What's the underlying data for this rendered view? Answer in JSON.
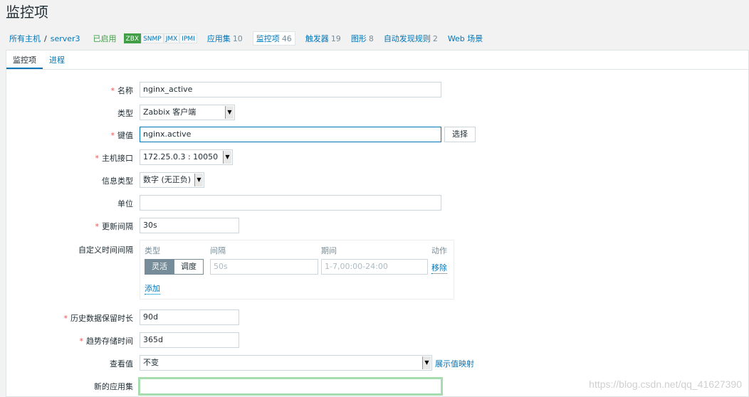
{
  "page": {
    "title": "监控项"
  },
  "breadcrumb": {
    "all_hosts": "所有主机",
    "separator": "/",
    "host": "server3",
    "status": "已启用",
    "badges": [
      "ZBX",
      "SNMP",
      "JMX",
      "IPMI"
    ],
    "links": [
      {
        "label": "应用集",
        "count": "10"
      },
      {
        "label": "监控项",
        "count": "46"
      },
      {
        "label": "触发器",
        "count": "19"
      },
      {
        "label": "图形",
        "count": "8"
      },
      {
        "label": "自动发现规则",
        "count": "2"
      },
      {
        "label": "Web 场景",
        "count": ""
      }
    ]
  },
  "tabs": [
    "监控项",
    "进程"
  ],
  "form": {
    "name": {
      "label": "名称",
      "value": "nginx_active"
    },
    "type": {
      "label": "类型",
      "value": "Zabbix 客户端"
    },
    "key": {
      "label": "键值",
      "value": "nginx.active",
      "select_button": "选择"
    },
    "interface": {
      "label": "主机接口",
      "value": "172.25.0.3 : 10050"
    },
    "info_type": {
      "label": "信息类型",
      "value": "数字 (无正负)"
    },
    "units": {
      "label": "单位",
      "value": ""
    },
    "interval": {
      "label": "更新间隔",
      "value": "30s"
    },
    "custom_intervals": {
      "label": "自定义时间间隔",
      "headers": [
        "类型",
        "间隔",
        "期间",
        "动作"
      ],
      "mode_flexible": "灵活",
      "mode_scheduling": "调度",
      "interval_placeholder": "50s",
      "period_placeholder": "1-7,00:00-24:00",
      "remove": "移除",
      "add": "添加"
    },
    "history": {
      "label": "历史数据保留时长",
      "value": "90d"
    },
    "trends": {
      "label": "趋势存储时间",
      "value": "365d"
    },
    "show_value": {
      "label": "查看值",
      "value": "不变",
      "link": "展示值映射"
    },
    "new_application": {
      "label": "新的应用集",
      "value": ""
    }
  },
  "watermark": "https://blog.csdn.net/qq_41627390",
  "colors": {
    "accent": "#0275b8",
    "required": "#e45959",
    "enabled": "#429e47"
  }
}
